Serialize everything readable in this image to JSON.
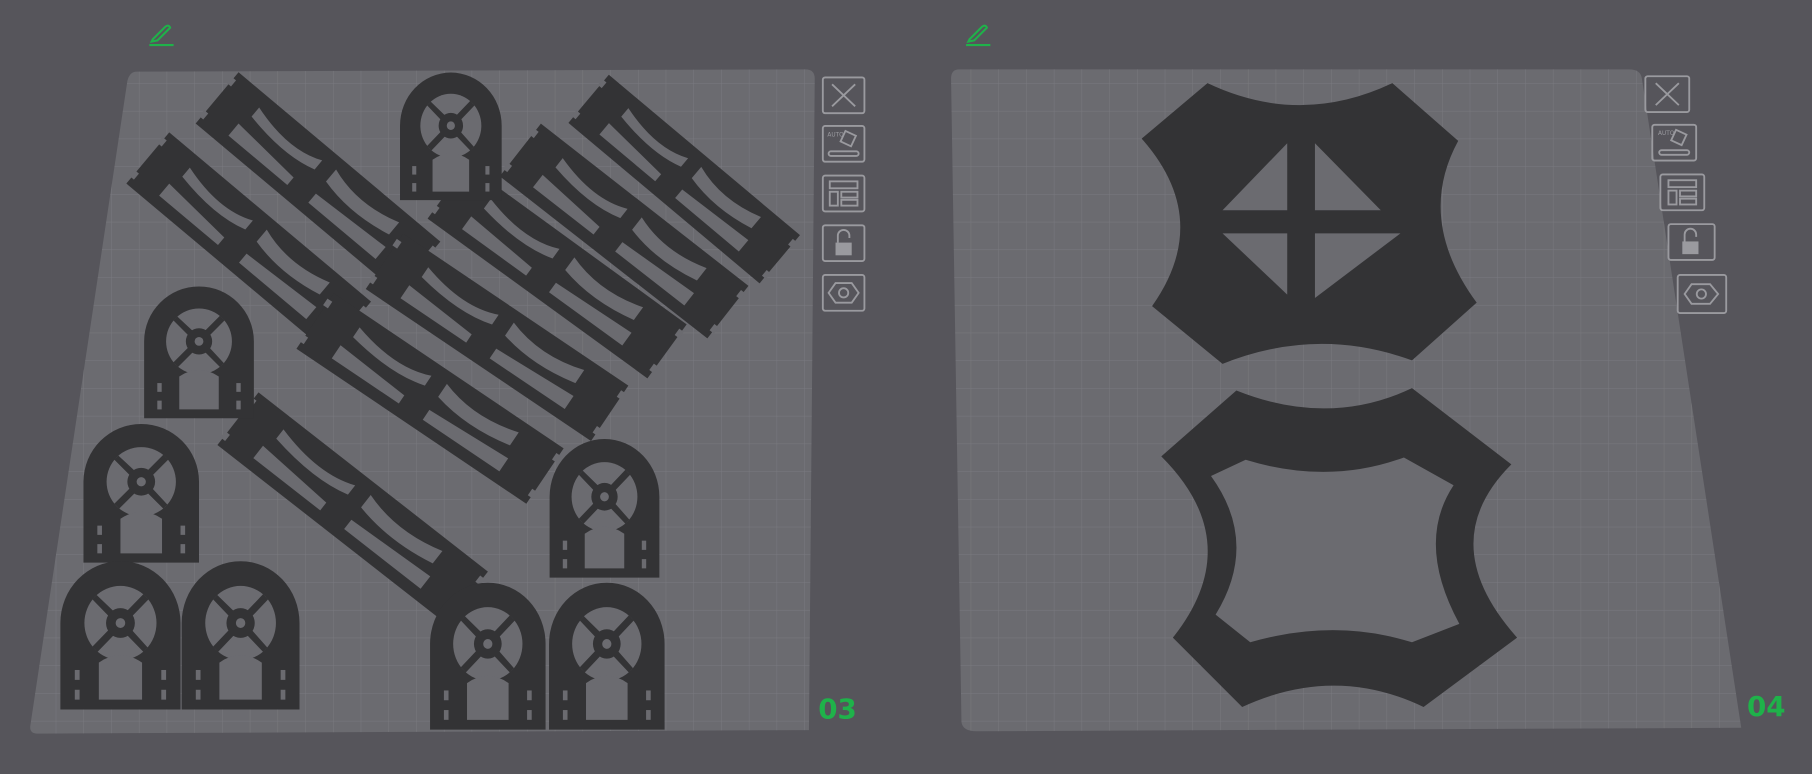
{
  "colors": {
    "background": "#56555b",
    "plate": "#6b6b70",
    "grid": "#7a7a80",
    "part": "#333335",
    "accent": "#1fb24a",
    "icon_stroke": "#9a9a9f"
  },
  "plates": [
    {
      "label": "03",
      "edit_icon": "pencil-icon",
      "toolbar": [
        {
          "name": "close",
          "icon": "close-icon"
        },
        {
          "name": "auto-arrange",
          "icon": "auto-arrange-icon",
          "text": "AUTO"
        },
        {
          "name": "layout",
          "icon": "layout-icon"
        },
        {
          "name": "lock",
          "icon": "unlock-icon"
        },
        {
          "name": "settings",
          "icon": "hex-nut-icon"
        }
      ]
    },
    {
      "label": "04",
      "edit_icon": "pencil-icon",
      "toolbar": [
        {
          "name": "close",
          "icon": "close-icon"
        },
        {
          "name": "auto-arrange",
          "icon": "auto-arrange-icon",
          "text": "AUTO"
        },
        {
          "name": "layout",
          "icon": "layout-icon"
        },
        {
          "name": "lock",
          "icon": "unlock-icon"
        },
        {
          "name": "settings",
          "icon": "hex-nut-icon"
        }
      ]
    }
  ]
}
